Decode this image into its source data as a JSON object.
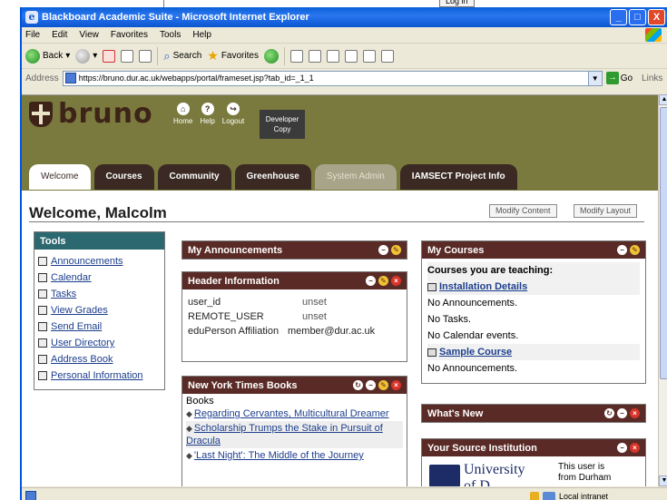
{
  "window": {
    "title": "Blackboard Academic Suite - Microsoft Internet Explorer",
    "login_button": "Log in",
    "controls": {
      "minimize": "_",
      "maximize": "□",
      "close": "X"
    }
  },
  "menu": [
    "File",
    "Edit",
    "View",
    "Favorites",
    "Tools",
    "Help"
  ],
  "toolbar": {
    "back": "Back",
    "search": "Search",
    "favorites": "Favorites"
  },
  "address": {
    "label": "Address",
    "url": "https://bruno.dur.ac.uk/webapps/portal/frameset.jsp?tab_id=_1_1",
    "go": "Go",
    "links": "Links"
  },
  "header": {
    "logo_text": "bruno",
    "nav": [
      {
        "label": "Home",
        "icon": "home-icon",
        "glyph": "⌂"
      },
      {
        "label": "Help",
        "icon": "help-icon",
        "glyph": "?"
      },
      {
        "label": "Logout",
        "icon": "logout-icon",
        "glyph": "↪"
      }
    ],
    "dev_copy": [
      "Developer",
      "Copy"
    ]
  },
  "tabs": [
    {
      "label": "Welcome",
      "state": "active"
    },
    {
      "label": "Courses",
      "state": "normal"
    },
    {
      "label": "Community",
      "state": "normal"
    },
    {
      "label": "Greenhouse",
      "state": "normal"
    },
    {
      "label": "System Admin",
      "state": "disabled"
    },
    {
      "label": "IAMSECT Project Info",
      "state": "normal"
    }
  ],
  "page": {
    "welcome": "Welcome, Malcolm",
    "modify_content": "Modify Content",
    "modify_layout": "Modify Layout"
  },
  "tools": {
    "title": "Tools",
    "items": [
      "Announcements",
      "Calendar",
      "Tasks",
      "View Grades",
      "Send Email",
      "User Directory",
      "Address Book",
      "Personal Information"
    ]
  },
  "announcements": {
    "title": "My Announcements"
  },
  "header_info": {
    "title": "Header Information",
    "rows": [
      {
        "key": "user_id",
        "value": "unset"
      },
      {
        "key": "REMOTE_USER",
        "value": "unset"
      },
      {
        "key": "eduPerson Affiliation",
        "value": "member@dur.ac.uk"
      }
    ]
  },
  "nyt": {
    "title": "New York Times Books",
    "heading": "Books",
    "items": [
      "Regarding Cervantes, Multicultural Dreamer",
      "Scholarship Trumps the Stake in Pursuit of Dracula",
      "'Last Night': The Middle of the Journey"
    ]
  },
  "my_courses": {
    "title": "My Courses",
    "teaching": "Courses you are teaching:",
    "rows": [
      {
        "type": "link",
        "text": "Installation Details"
      },
      {
        "type": "text",
        "text": "No Announcements."
      },
      {
        "type": "text",
        "text": "No Tasks."
      },
      {
        "type": "text",
        "text": "No Calendar events."
      },
      {
        "type": "link",
        "text": "Sample Course"
      },
      {
        "type": "text",
        "text": "No Announcements."
      }
    ]
  },
  "whats_new": {
    "title": "What's New"
  },
  "source": {
    "title": "Your Source Institution",
    "logo_text": "University",
    "logo_sub": "of D",
    "text": [
      "This user is",
      "from Durham"
    ]
  },
  "status": {
    "zone": "Local intranet"
  }
}
